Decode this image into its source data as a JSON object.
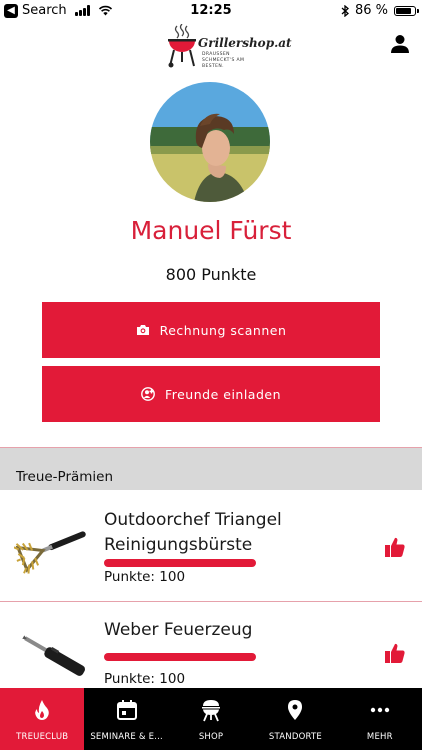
{
  "status_bar": {
    "back_app": "Search",
    "time": "12:25",
    "battery": "86 %",
    "battery_level": 0.86
  },
  "header": {
    "logo_text": "Grillershop.at",
    "logo_tagline": "DRAUSSEN SCHMECKT'S AM BESTEN."
  },
  "profile": {
    "name": "Manuel Fürst",
    "points": "800 Punkte"
  },
  "actions": {
    "scan_label": "Rechnung scannen",
    "invite_label": "Freunde einladen"
  },
  "rewards": {
    "section_title": "Treue-Prämien",
    "items": [
      {
        "title": "Outdoorchef Triangel Reinigungsbürste",
        "points": "Punkte: 100",
        "progress": 1.0
      },
      {
        "title": "Weber Feuerzeug",
        "points": "Punkte: 100",
        "progress": 1.0
      }
    ]
  },
  "nav": {
    "items": [
      {
        "label": "TREUECLUB",
        "icon": "flame-icon",
        "active": true
      },
      {
        "label": "SEMINARE & E...",
        "icon": "calendar-icon",
        "active": false
      },
      {
        "label": "SHOP",
        "icon": "grill-icon",
        "active": false
      },
      {
        "label": "STANDORTE",
        "icon": "location-pin-icon",
        "active": false
      },
      {
        "label": "MEHR",
        "icon": "more-icon",
        "active": false
      }
    ]
  },
  "colors": {
    "accent": "#e21a38",
    "name_color": "#d8203a",
    "nav_background": "#000000",
    "section_background": "#d8d8d8"
  }
}
